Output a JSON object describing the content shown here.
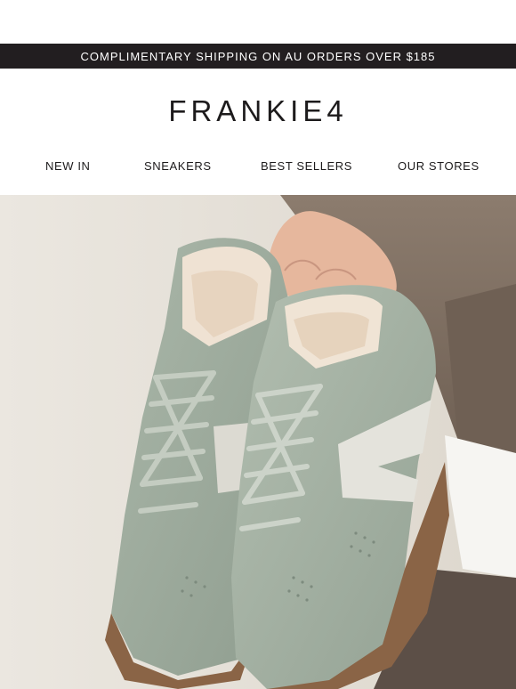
{
  "promo": {
    "text": "COMPLIMENTARY SHIPPING ON AU ORDERS OVER $185"
  },
  "brand": {
    "logo": "FRANKIE4"
  },
  "nav": {
    "items": [
      {
        "label": "NEW IN"
      },
      {
        "label": "SNEAKERS"
      },
      {
        "label": "BEST SELLERS"
      },
      {
        "label": "OUR STORES"
      }
    ]
  },
  "hero": {
    "image": "sage-green-suede-sneakers-held-in-hand",
    "colors": {
      "background": "#e8e4dd",
      "suede": "#a3b0a2",
      "stripe": "#e4e3dc",
      "sole": "#8a6446",
      "sweater": "#7a6a5c"
    }
  }
}
